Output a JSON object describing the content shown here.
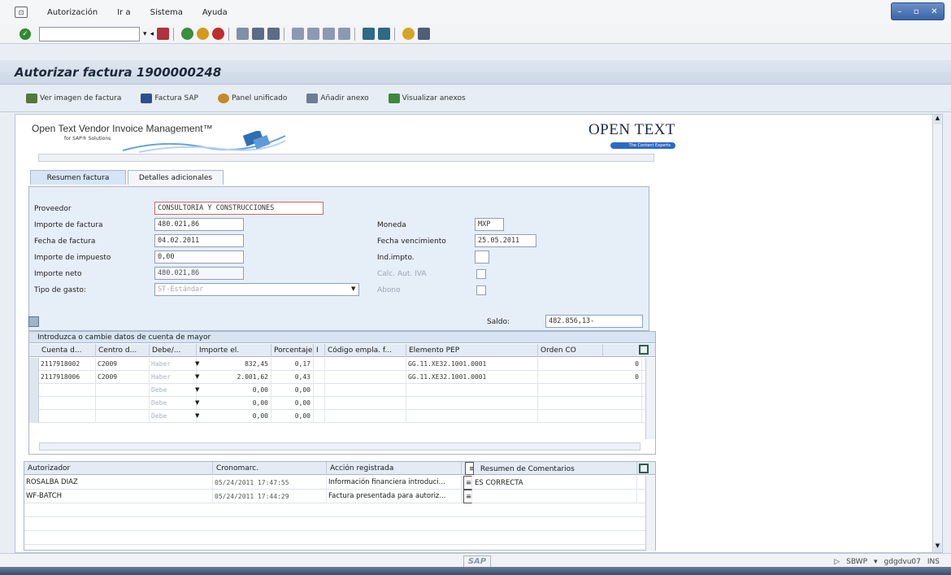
{
  "menu": {
    "items": [
      "Autorización",
      "Ir a",
      "Sistema",
      "Ayuda"
    ]
  },
  "title": "Autorizar factura 1900000248",
  "app_toolbar": {
    "buttons": [
      "Ver imagen de factura",
      "Factura SAP",
      "Panel unificado",
      "Añadir anexo",
      "Visualizar anexos"
    ]
  },
  "banner": {
    "product": "Open Text Vendor Invoice Management™",
    "sub": "for SAP® Solutions",
    "logo": "OPEN TEXT",
    "logo_tag": "The Content Experts"
  },
  "tabs": [
    "Resumen factura",
    "Detalles adicionales"
  ],
  "form": {
    "proveedor_label": "Proveedor",
    "proveedor_value": "CONSULTORIA Y CONSTRUCCIONES",
    "importe_factura_label": "Importe de factura",
    "importe_factura_value": "480.021,86",
    "fecha_factura_label": "Fecha de factura",
    "fecha_factura_value": "04.02.2011",
    "importe_impuesto_label": "Importe de impuesto",
    "importe_impuesto_value": "0,00",
    "importe_neto_label": "Importe neto",
    "importe_neto_value": "480.021,86",
    "tipo_gasto_label": "Tipo de gasto:",
    "tipo_gasto_value": "ST-Estándar",
    "moneda_label": "Moneda",
    "moneda_value": "MXP",
    "fecha_venc_label": "Fecha vencimiento",
    "fecha_venc_value": "25.05.2011",
    "ind_impto_label": "Ind.impto.",
    "calc_iva_label": "Calc. Aut. IVA",
    "abono_label": "Abono"
  },
  "saldo": {
    "label": "Saldo:",
    "value": "482.856,13-"
  },
  "gl_table": {
    "title": "Introduzca o cambie datos de cuenta de mayor",
    "columns": [
      "Cuenta d...",
      "Centro d...",
      "Debe/...",
      "Importe el.",
      "Porcentaje",
      "I",
      "Código empla. f...",
      "Elemento PEP",
      "Orden CO"
    ],
    "rows": [
      {
        "cuenta": "2117918002",
        "centro": "C2009",
        "debe": "Haber",
        "importe": "832,45",
        "porcentaje": "0,17",
        "pep": "GG.11.XE32.1001.0001",
        "orden": "0"
      },
      {
        "cuenta": "2117918006",
        "centro": "C2009",
        "debe": "Haber",
        "importe": "2.001,62",
        "porcentaje": "0,43",
        "pep": "GG.11.XE32.1001.0001",
        "orden": "0"
      },
      {
        "cuenta": "",
        "centro": "",
        "debe": "Debe",
        "importe": "0,00",
        "porcentaje": "0,00",
        "pep": "",
        "orden": ""
      },
      {
        "cuenta": "",
        "centro": "",
        "debe": "Debe",
        "importe": "0,00",
        "porcentaje": "0,00",
        "pep": "",
        "orden": ""
      },
      {
        "cuenta": "",
        "centro": "",
        "debe": "Debe",
        "importe": "0,00",
        "porcentaje": "0,00",
        "pep": "",
        "orden": ""
      }
    ]
  },
  "approvers": {
    "columns": [
      "Autorizador",
      "Cronomarc.",
      "Acción registrada",
      "Resumen de Comentarios"
    ],
    "rows": [
      {
        "autorizador": "ROSALBA  DIAZ",
        "crono": "05/24/2011 17:47:55",
        "accion": "Información financiera introduci...",
        "comentario": "ES CORRECTA"
      },
      {
        "autorizador": "WF-BATCH",
        "crono": "05/24/2011 17:44:29",
        "accion": "Factura presentada para autoriz...",
        "comentario": ""
      }
    ]
  },
  "status": {
    "sap_mark": "SAP",
    "system": "SBWP",
    "server": "gdgdvu07",
    "mode": "INS"
  }
}
